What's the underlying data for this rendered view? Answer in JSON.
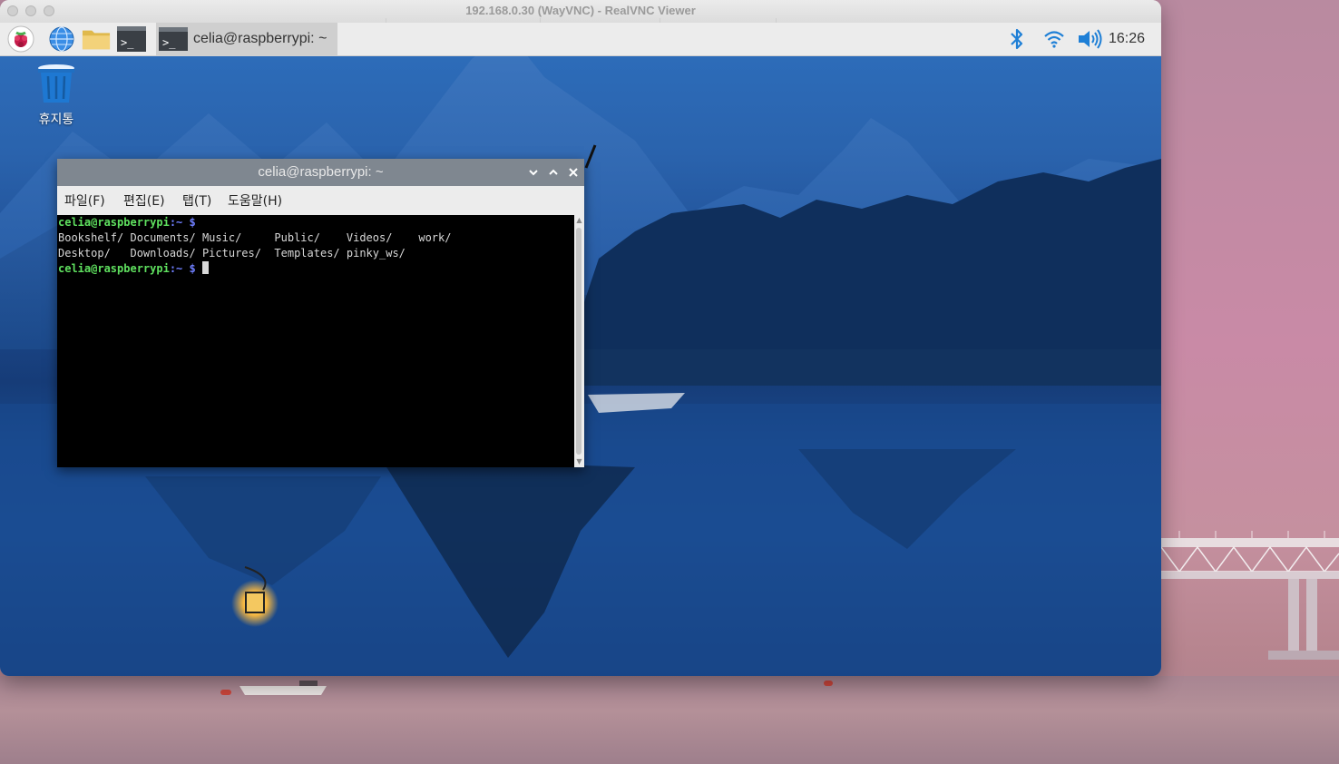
{
  "vnc_window": {
    "title": "192.168.0.30 (WayVNC) - RealVNC Viewer"
  },
  "taskbar": {
    "launchers": [
      {
        "name": "raspberry-menu-icon"
      },
      {
        "name": "web-browser-icon"
      },
      {
        "name": "file-manager-icon"
      },
      {
        "name": "terminal-launcher-icon"
      }
    ],
    "task_button": {
      "label": "celia@raspberrypi: ~"
    },
    "tray": {
      "bluetooth_icon": "bluetooth-icon",
      "wifi_icon": "wifi-icon",
      "volume_icon": "volume-icon",
      "clock": "16:26"
    }
  },
  "desktop": {
    "trash_label": "휴지통"
  },
  "terminal": {
    "title": "celia@raspberrypi: ~",
    "menu": [
      "파일(F)",
      "편집(E)",
      "탭(T)",
      "도움말(H)"
    ],
    "prompt_user": "celia@raspberrypi",
    "prompt_path": ":~ $",
    "output_lines": [
      "Bookshelf/ Documents/ Music/     Public/    Videos/    work/",
      "Desktop/   Downloads/ Pictures/  Templates/ pinky_ws/"
    ]
  },
  "colors": {
    "taskbar_bg": "#ececec",
    "terminal_titlebar": "#7f8790",
    "prompt_user": "#5fe05f",
    "prompt_path": "#6f7fff",
    "tray_icon": "#1e7fd6"
  }
}
